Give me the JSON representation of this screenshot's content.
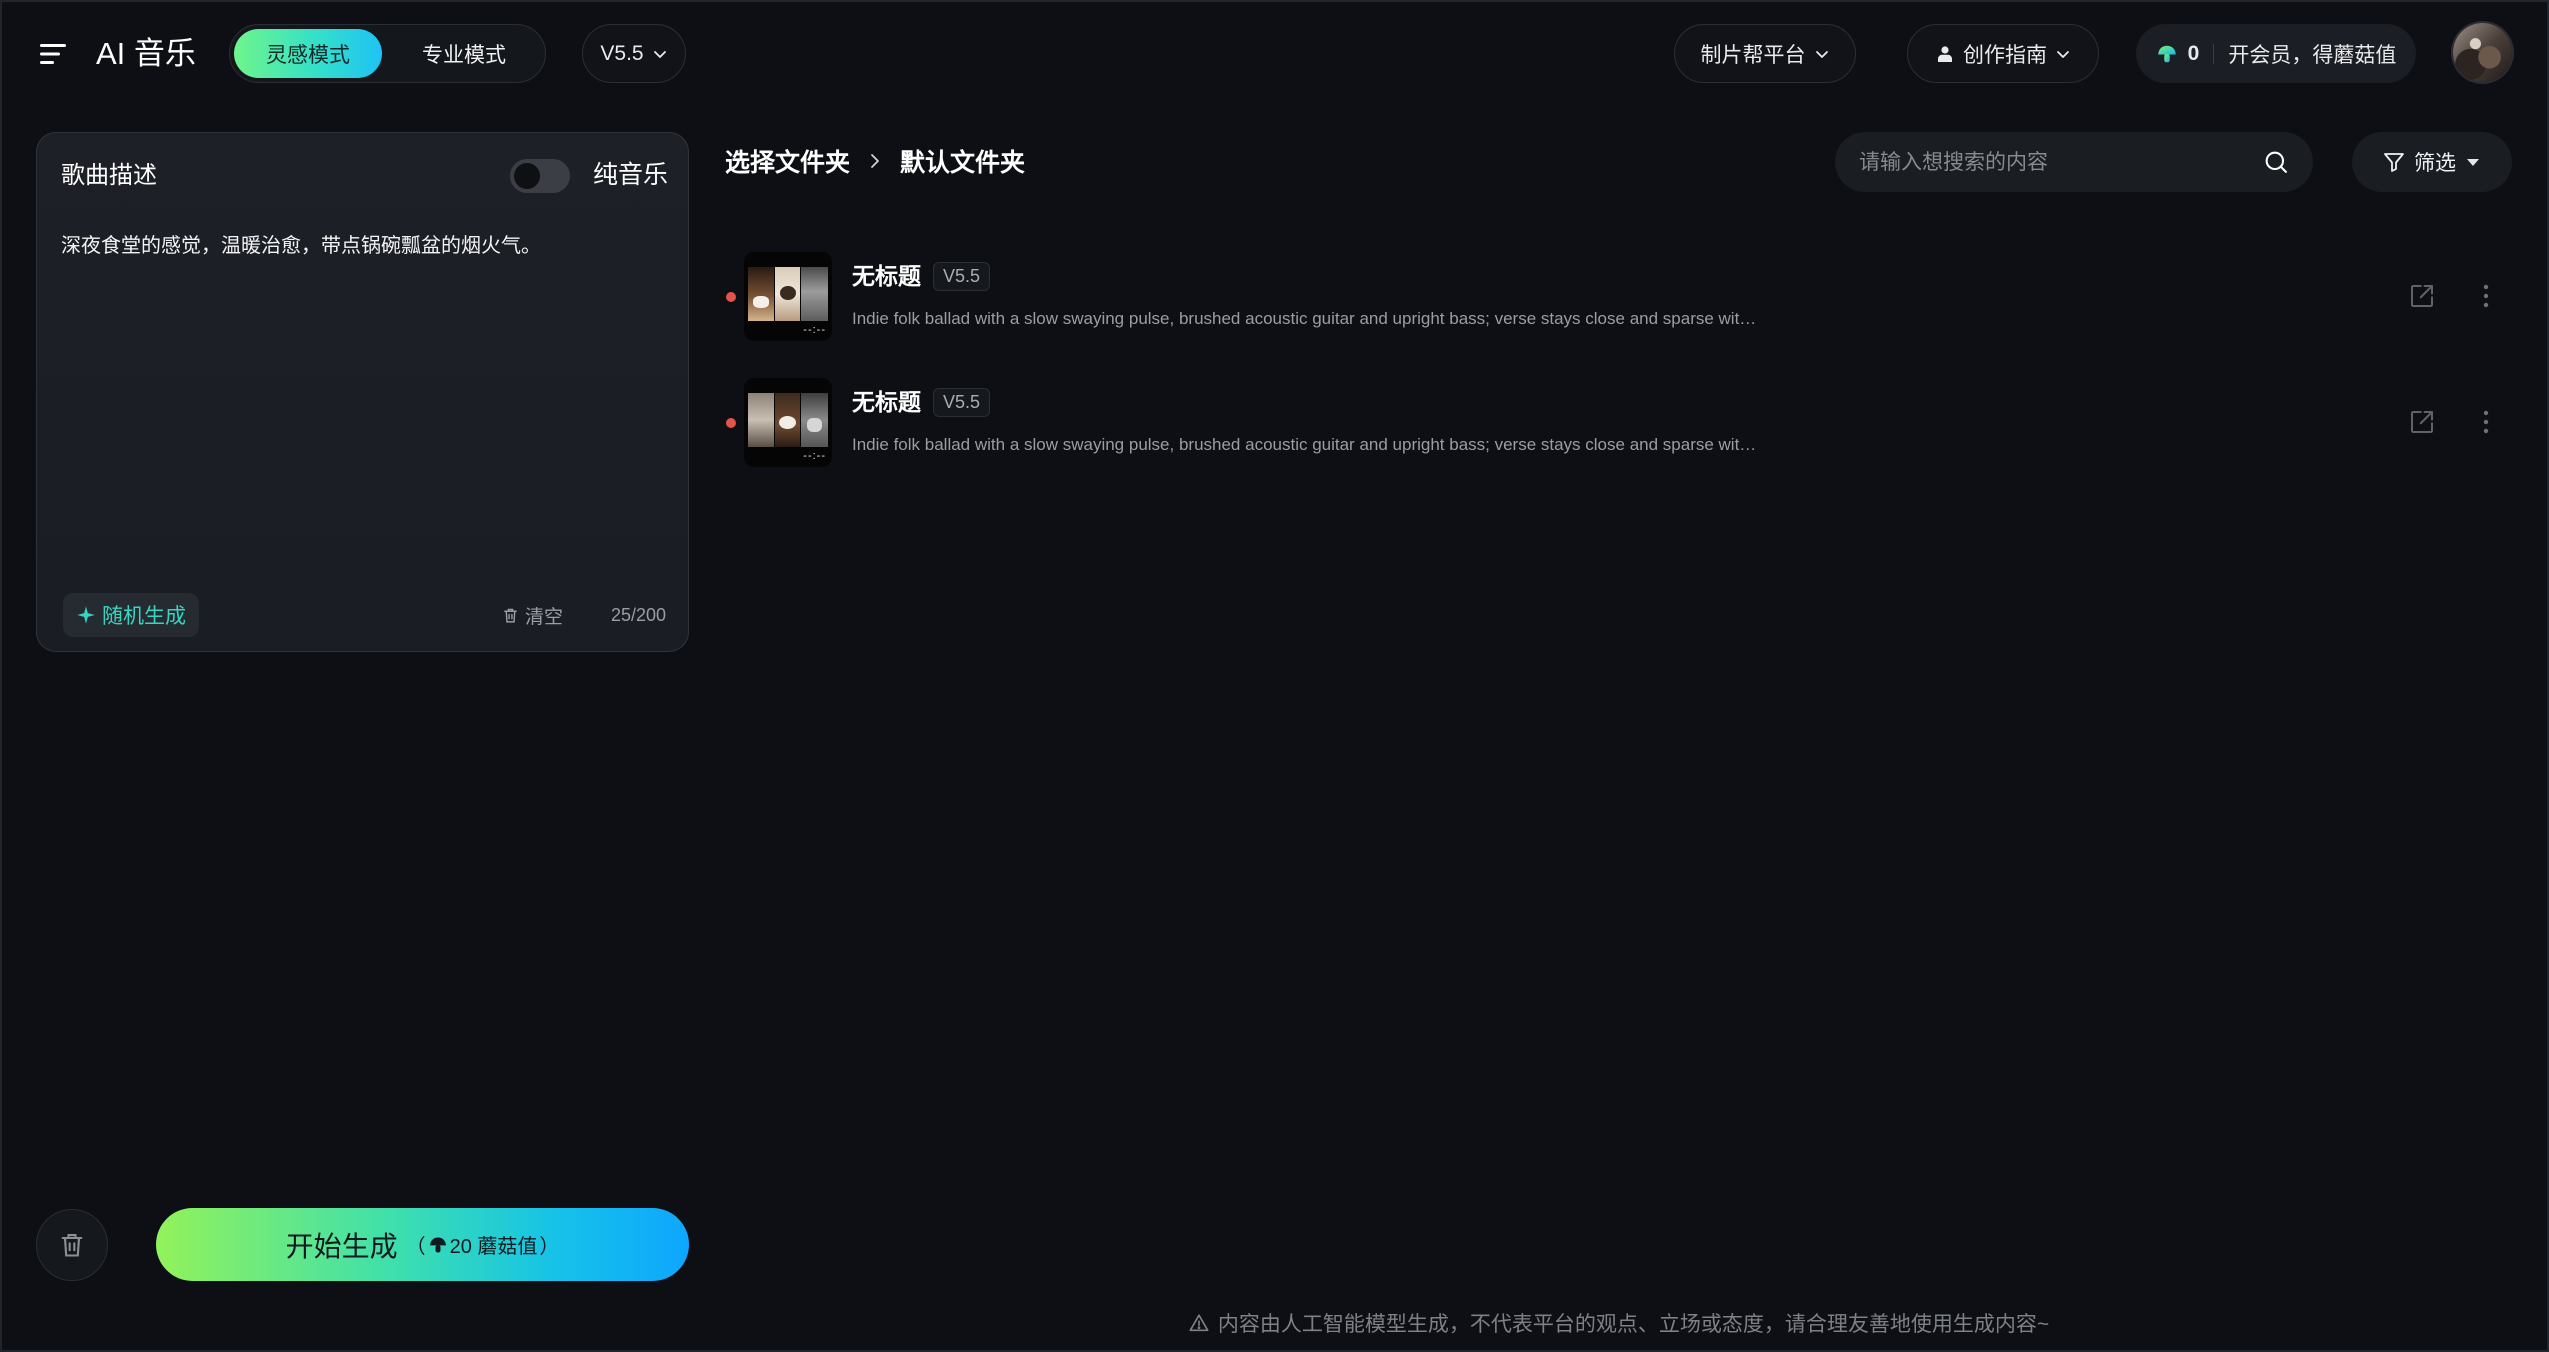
{
  "header": {
    "app_title": "AI 音乐",
    "modes": [
      {
        "label": "灵感模式",
        "active": true
      },
      {
        "label": "专业模式",
        "active": false
      }
    ],
    "version": "V5.5",
    "platform_label": "制片帮平台",
    "guide_label": "创作指南",
    "credit_balance": "0",
    "membership_label": "开会员，得蘑菇值"
  },
  "composer": {
    "title": "歌曲描述",
    "instrumental_label": "纯音乐",
    "instrumental_enabled": false,
    "description": "深夜食堂的感觉，温暖治愈，带点锅碗瓢盆的烟火气。",
    "random_label": "随机生成",
    "clear_label": "清空",
    "char_count": "25/200",
    "generate_label": "开始生成",
    "generate_cost_open": "（",
    "generate_cost": "20 蘑菇值",
    "generate_cost_close": "）"
  },
  "library": {
    "breadcrumb_root": "选择文件夹",
    "breadcrumb_current": "默认文件夹",
    "search_placeholder": "请输入想搜索的内容",
    "filter_label": "筛选",
    "songs": [
      {
        "title": "无标题",
        "version": "V5.5",
        "description": "Indie folk ballad with a slow swaying pulse, brushed acoustic guitar and upright bass; verse stays close and sparse wit…",
        "duration": "--:--",
        "unread": true
      },
      {
        "title": "无标题",
        "version": "V5.5",
        "description": "Indie folk ballad with a slow swaying pulse, brushed acoustic guitar and upright bass; verse stays close and sparse wit…",
        "duration": "--:--",
        "unread": true
      }
    ]
  },
  "footer": {
    "disclaimer": "内容由人工智能模型生成，不代表平台的观点、立场或态度，请合理友善地使用生成内容~"
  },
  "icons": [
    "menu-icon",
    "chevron-down-icon",
    "person-icon",
    "mushroom-icon",
    "sparkle-icon",
    "trash-icon",
    "search-icon",
    "filter-icon",
    "caret-down-icon",
    "chevron-right-icon",
    "share-icon",
    "more-vertical-icon",
    "warning-icon"
  ],
  "colors": {
    "background": "#0d0f14",
    "accent_start": "#6ff58a",
    "accent_end": "#0ea6ff",
    "teal": "#36d6c3",
    "unread_dot": "#e5534b"
  }
}
